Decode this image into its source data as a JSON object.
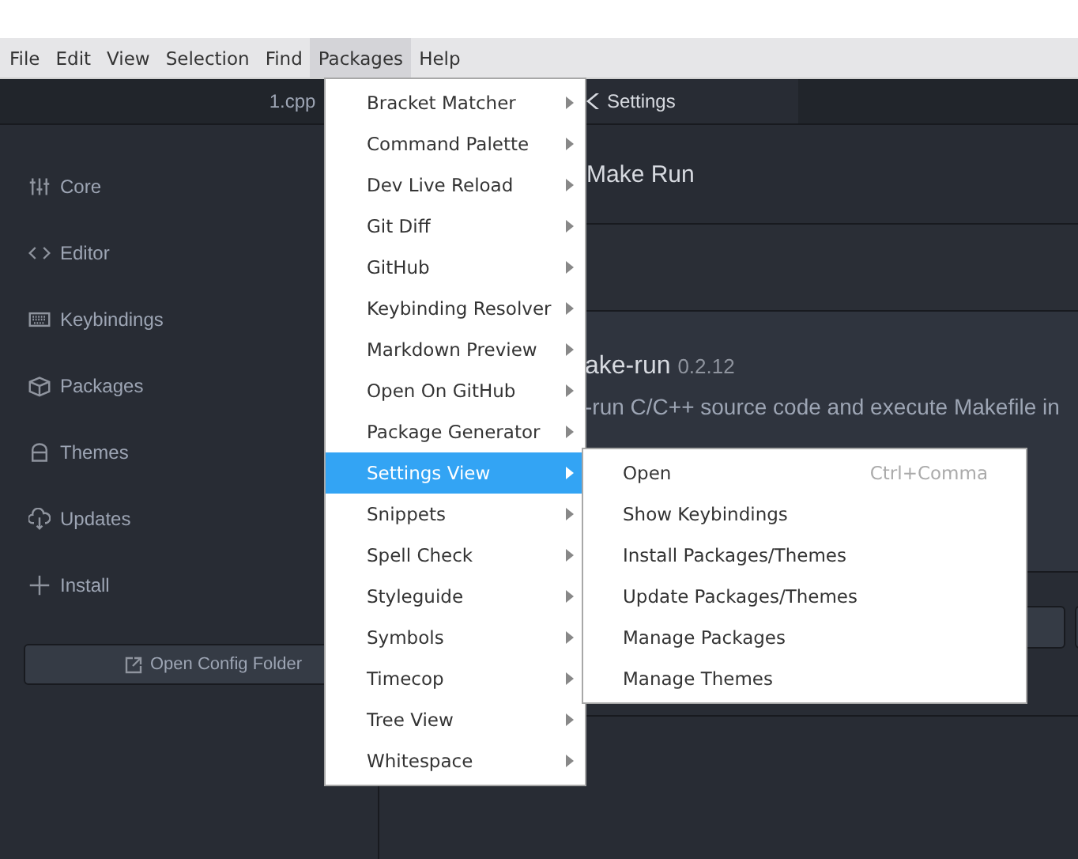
{
  "menubar": [
    {
      "label": "File",
      "selected": false
    },
    {
      "label": "Edit",
      "selected": false
    },
    {
      "label": "View",
      "selected": false
    },
    {
      "label": "Selection",
      "selected": false
    },
    {
      "label": "Find",
      "selected": false
    },
    {
      "label": "Packages",
      "selected": true
    },
    {
      "label": "Help",
      "selected": false
    }
  ],
  "tabs": [
    {
      "label": "1.cpp",
      "selected": false
    },
    {
      "label": "Settings",
      "selected": true
    }
  ],
  "sidebar": {
    "items": [
      {
        "label": "Core"
      },
      {
        "label": "Editor"
      },
      {
        "label": "Keybindings"
      },
      {
        "label": "Packages"
      },
      {
        "label": "Themes"
      },
      {
        "label": "Updates"
      },
      {
        "label": "Install"
      }
    ],
    "open_config_button": "Open Config Folder"
  },
  "header": {
    "title": "Make Run"
  },
  "package": {
    "name": "ake-run",
    "version": "0.2.12",
    "description": "-run C/C++ source code and execute Makefile in"
  },
  "packages_menu": [
    {
      "label": "Bracket Matcher",
      "selected": false
    },
    {
      "label": "Command Palette",
      "selected": false
    },
    {
      "label": "Dev Live Reload",
      "selected": false
    },
    {
      "label": "Git Diff",
      "selected": false
    },
    {
      "label": "GitHub",
      "selected": false
    },
    {
      "label": "Keybinding Resolver",
      "selected": false
    },
    {
      "label": "Markdown Preview",
      "selected": false
    },
    {
      "label": "Open On GitHub",
      "selected": false
    },
    {
      "label": "Package Generator",
      "selected": false
    },
    {
      "label": "Settings View",
      "selected": true
    },
    {
      "label": "Snippets",
      "selected": false
    },
    {
      "label": "Spell Check",
      "selected": false
    },
    {
      "label": "Styleguide",
      "selected": false
    },
    {
      "label": "Symbols",
      "selected": false
    },
    {
      "label": "Timecop",
      "selected": false
    },
    {
      "label": "Tree View",
      "selected": false
    },
    {
      "label": "Whitespace",
      "selected": false
    }
  ],
  "submenu": [
    {
      "label": "Open",
      "shortcut": "Ctrl+Comma"
    },
    {
      "label": "Show Keybindings"
    },
    {
      "label": "Install Packages/Themes"
    },
    {
      "label": "Update Packages/Themes"
    },
    {
      "label": "Manage Packages"
    },
    {
      "label": "Manage Themes"
    }
  ]
}
